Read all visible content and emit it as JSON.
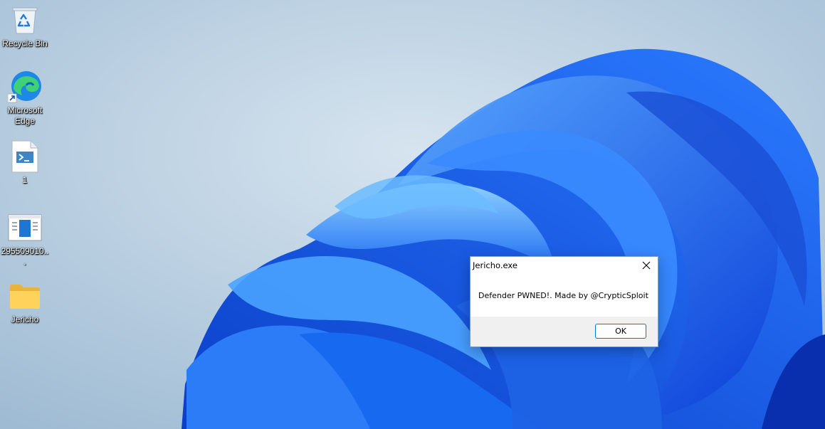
{
  "desktop": {
    "icons": [
      {
        "label": "Recycle Bin",
        "icon": "recycle-bin-icon"
      },
      {
        "label": "Microsoft Edge",
        "icon": "edge-icon"
      },
      {
        "label": "1",
        "icon": "powershell-script-icon"
      },
      {
        "label": "295509010...",
        "icon": "app-window-icon"
      },
      {
        "label": "Jericho",
        "icon": "folder-icon"
      }
    ]
  },
  "dialog": {
    "title": "Jericho.exe",
    "message": "Defender PWNED!. Made by @CrypticSploit",
    "ok_label": "OK",
    "close_icon": "close-icon"
  },
  "colors": {
    "bloom_blue": "#1f6ef5",
    "sky": "#b7cde0",
    "dialog_button_border": "#0078d4"
  }
}
